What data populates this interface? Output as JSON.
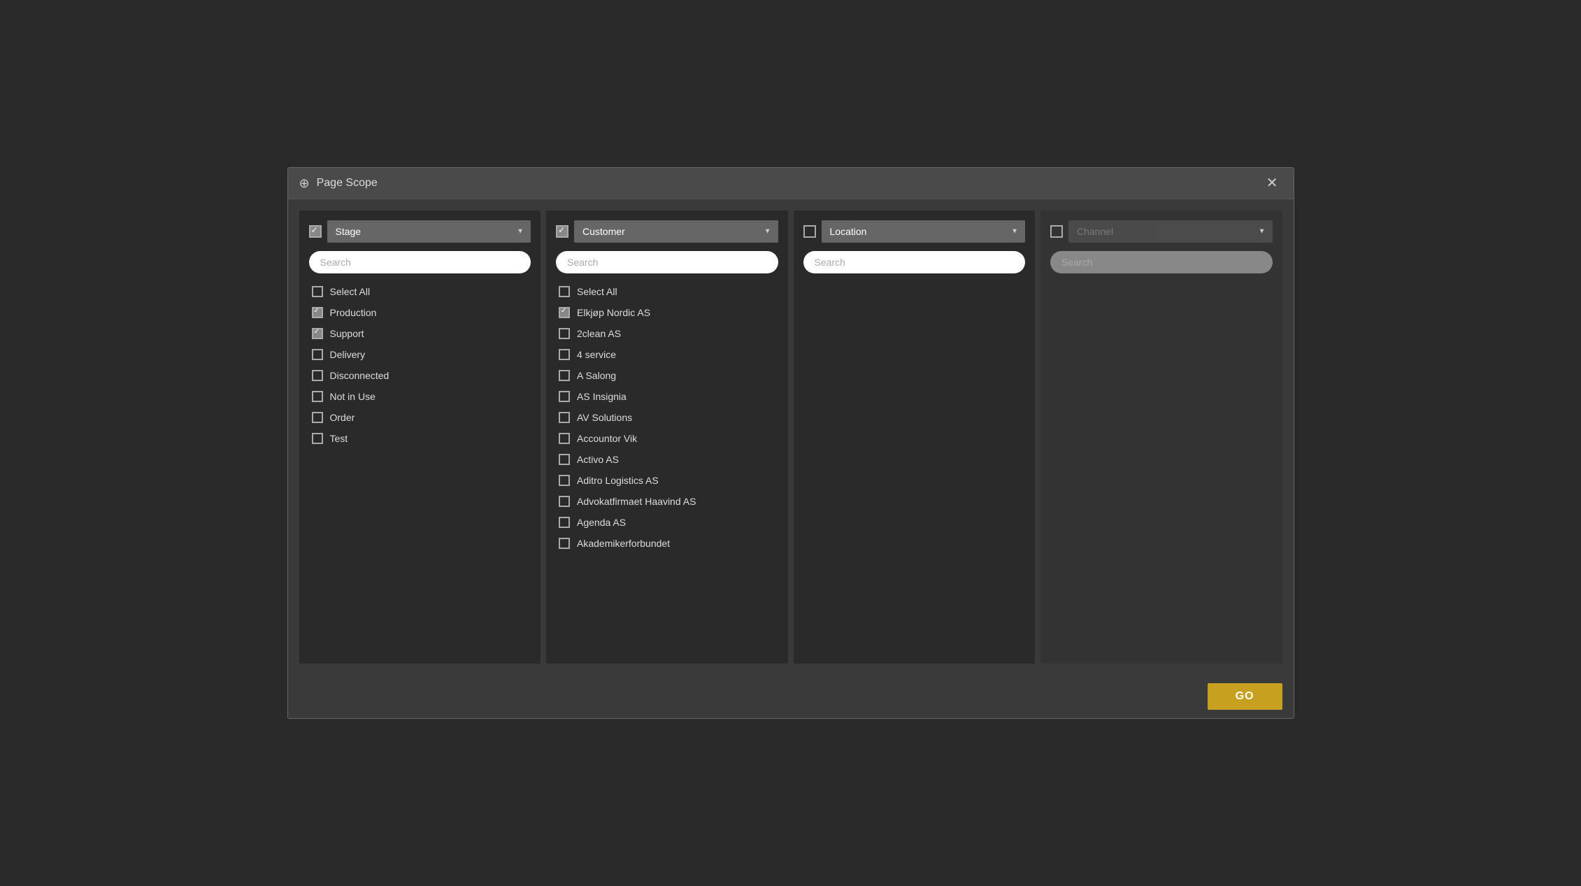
{
  "modal": {
    "title": "Page Scope",
    "close_label": "✕"
  },
  "columns": [
    {
      "id": "stage",
      "label": "Stage",
      "checked": true,
      "search_placeholder": "Search",
      "disabled": false,
      "items": [
        {
          "label": "Select All",
          "checked": false
        },
        {
          "label": "Production",
          "checked": true
        },
        {
          "label": "Support",
          "checked": true
        },
        {
          "label": "Delivery",
          "checked": false
        },
        {
          "label": "Disconnected",
          "checked": false
        },
        {
          "label": "Not in Use",
          "checked": false
        },
        {
          "label": "Order",
          "checked": false
        },
        {
          "label": "Test",
          "checked": false
        }
      ]
    },
    {
      "id": "customer",
      "label": "Customer",
      "checked": true,
      "search_placeholder": "Search",
      "disabled": false,
      "items": [
        {
          "label": "Select All",
          "checked": false
        },
        {
          "label": "Elkjøp Nordic AS",
          "checked": true
        },
        {
          "label": "2clean AS",
          "checked": false
        },
        {
          "label": "4 service",
          "checked": false
        },
        {
          "label": "A Salong",
          "checked": false
        },
        {
          "label": "AS Insignia",
          "checked": false
        },
        {
          "label": "AV Solutions",
          "checked": false
        },
        {
          "label": "Accountor Vik",
          "checked": false
        },
        {
          "label": "Activo AS",
          "checked": false
        },
        {
          "label": "Aditro Logistics AS",
          "checked": false
        },
        {
          "label": "Advokatfirmaet Haavind AS",
          "checked": false
        },
        {
          "label": "Agenda AS",
          "checked": false
        },
        {
          "label": "Akademikerforbundet",
          "checked": false
        }
      ]
    },
    {
      "id": "location",
      "label": "Location",
      "checked": false,
      "search_placeholder": "Search",
      "disabled": false,
      "items": []
    },
    {
      "id": "channel",
      "label": "Channel",
      "checked": false,
      "search_placeholder": "Search",
      "disabled": true,
      "items": []
    }
  ],
  "footer": {
    "go_label": "GO"
  }
}
